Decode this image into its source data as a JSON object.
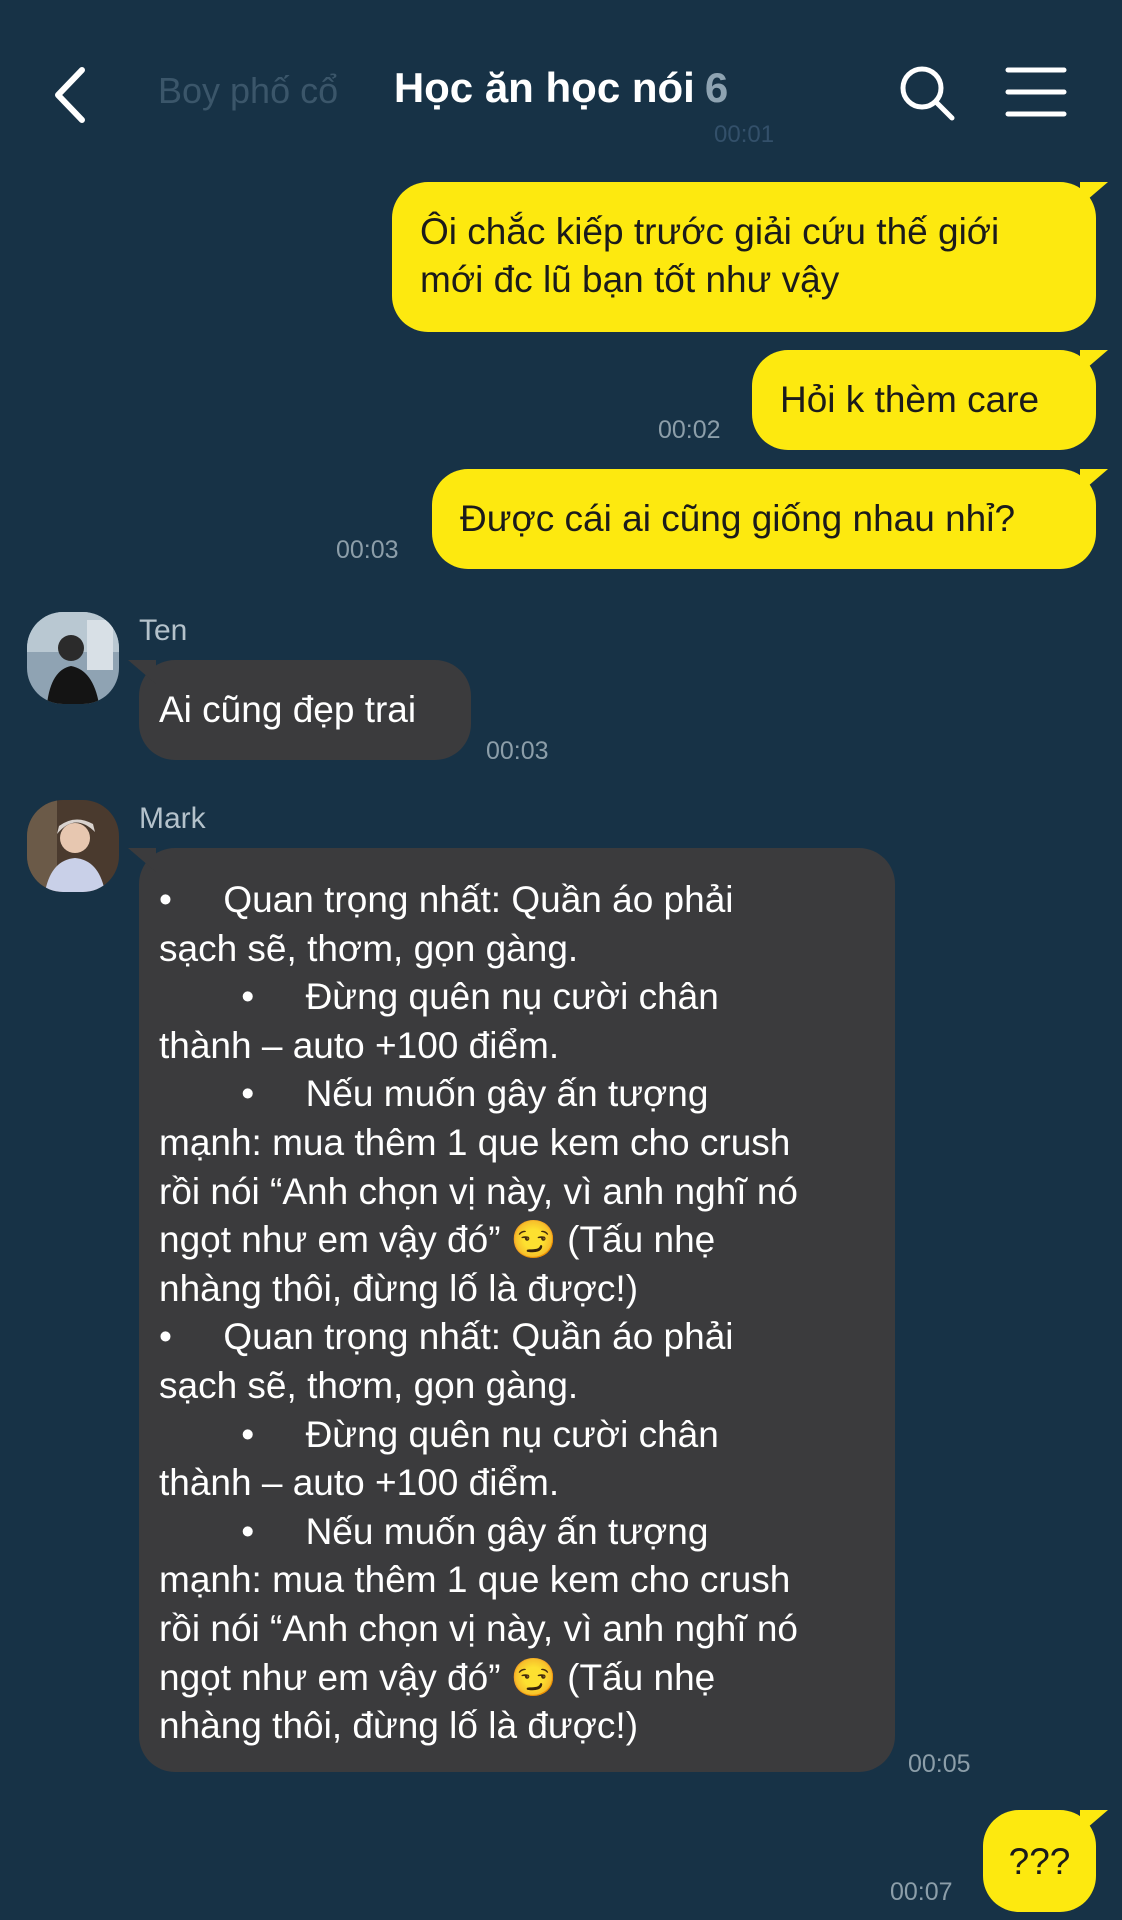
{
  "header": {
    "ghost_title": "Boy phố cổ",
    "ghost_time": "00:01",
    "title": "Học ăn học nói",
    "member_count": "6"
  },
  "messages": [
    {
      "side": "me",
      "lines": [
        "Ôi chắc kiếp trước giải cứu thế giới",
        "mới đc lũ bạn tốt như vậy"
      ],
      "time": ""
    },
    {
      "side": "me",
      "lines": [
        "Hỏi k thèm care"
      ],
      "time": "00:02"
    },
    {
      "side": "me",
      "lines": [
        "Được cái ai cũng giống nhau nhỉ?"
      ],
      "time": "00:03"
    },
    {
      "side": "them",
      "sender": "Ten",
      "lines": [
        "Ai cũng đẹp trai"
      ],
      "time": "00:03"
    },
    {
      "side": "them",
      "sender": "Mark",
      "lines": [
        "•     Quan trọng nhất: Quần áo phải",
        "sạch sẽ, thơm, gọn gàng.",
        "        •     Đừng quên nụ cười chân",
        "thành – auto +100 điểm.",
        "        •     Nếu muốn gây ấn tượng",
        "mạnh: mua thêm 1 que kem cho crush",
        "rồi nói “Anh chọn vị này, vì anh nghĩ nó",
        "ngọt như em vậy đó” 😏 (Tấu nhẹ",
        "nhàng thôi, đừng lố là được!)",
        "•     Quan trọng nhất: Quần áo phải",
        "sạch sẽ, thơm, gọn gàng.",
        "        •     Đừng quên nụ cười chân",
        "thành – auto +100 điểm.",
        "        •     Nếu muốn gây ấn tượng",
        "mạnh: mua thêm 1 que kem cho crush",
        "rồi nói “Anh chọn vị này, vì anh nghĩ nó",
        "ngọt như em vậy đó” 😏 (Tấu nhẹ",
        "nhàng thôi, đừng lố là được!)"
      ],
      "time": "00:05"
    },
    {
      "side": "me",
      "lines": [
        "???"
      ],
      "time": "00:07"
    }
  ],
  "colors": {
    "background": "#173246",
    "my_bubble": "#fde90f",
    "their_bubble": "#3b3b3d"
  },
  "icons": {
    "back": "chevron-left-icon",
    "search": "search-icon",
    "menu": "hamburger-menu-icon"
  }
}
